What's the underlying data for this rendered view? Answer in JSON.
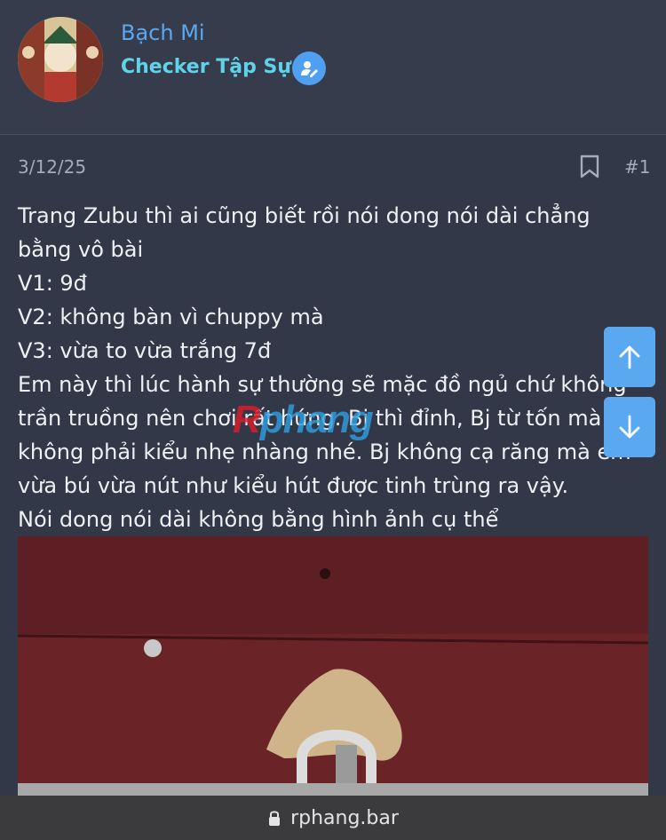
{
  "user": {
    "name": "Bạch Mi",
    "title": "Checker Tập Sự"
  },
  "post": {
    "date": "3/12/25",
    "number": "#1",
    "lines": [
      "Trang Zubu thì ai cũng biết rồi nói dong nói dài chẳng",
      "bằng vô bài",
      "V1: 9đ",
      "V2: không bàn vì chuppy mà",
      "V3: vừa to vừa trắng 7đ",
      "Em này thì lúc hành sự thường sẽ mặc đồ ngủ chứ không",
      "trần truồng nên chơi rất hứng. Bj thì đỉnh, Bj từ tốn mà",
      "không phải kiểu nhẹ nhàng nhé. Bj không cạ răng mà em",
      "vừa bú vừa nút như kiểu hút được tinh trùng ra vậy.",
      "Nói dong nói dài không bằng hình ảnh cụ thể"
    ]
  },
  "watermark": {
    "r": "R",
    "rest": "phang"
  },
  "browser": {
    "url": "rphang.bar"
  },
  "icons": {
    "badge": "user-edit-icon",
    "bookmark": "bookmark-icon",
    "scroll_up": "arrow-up-icon",
    "scroll_down": "arrow-down-icon",
    "lock": "lock-icon"
  },
  "colors": {
    "background": "#323848",
    "username": "#5aa8f0",
    "title": "#5fd3e8",
    "accent": "#5aa8f0"
  }
}
